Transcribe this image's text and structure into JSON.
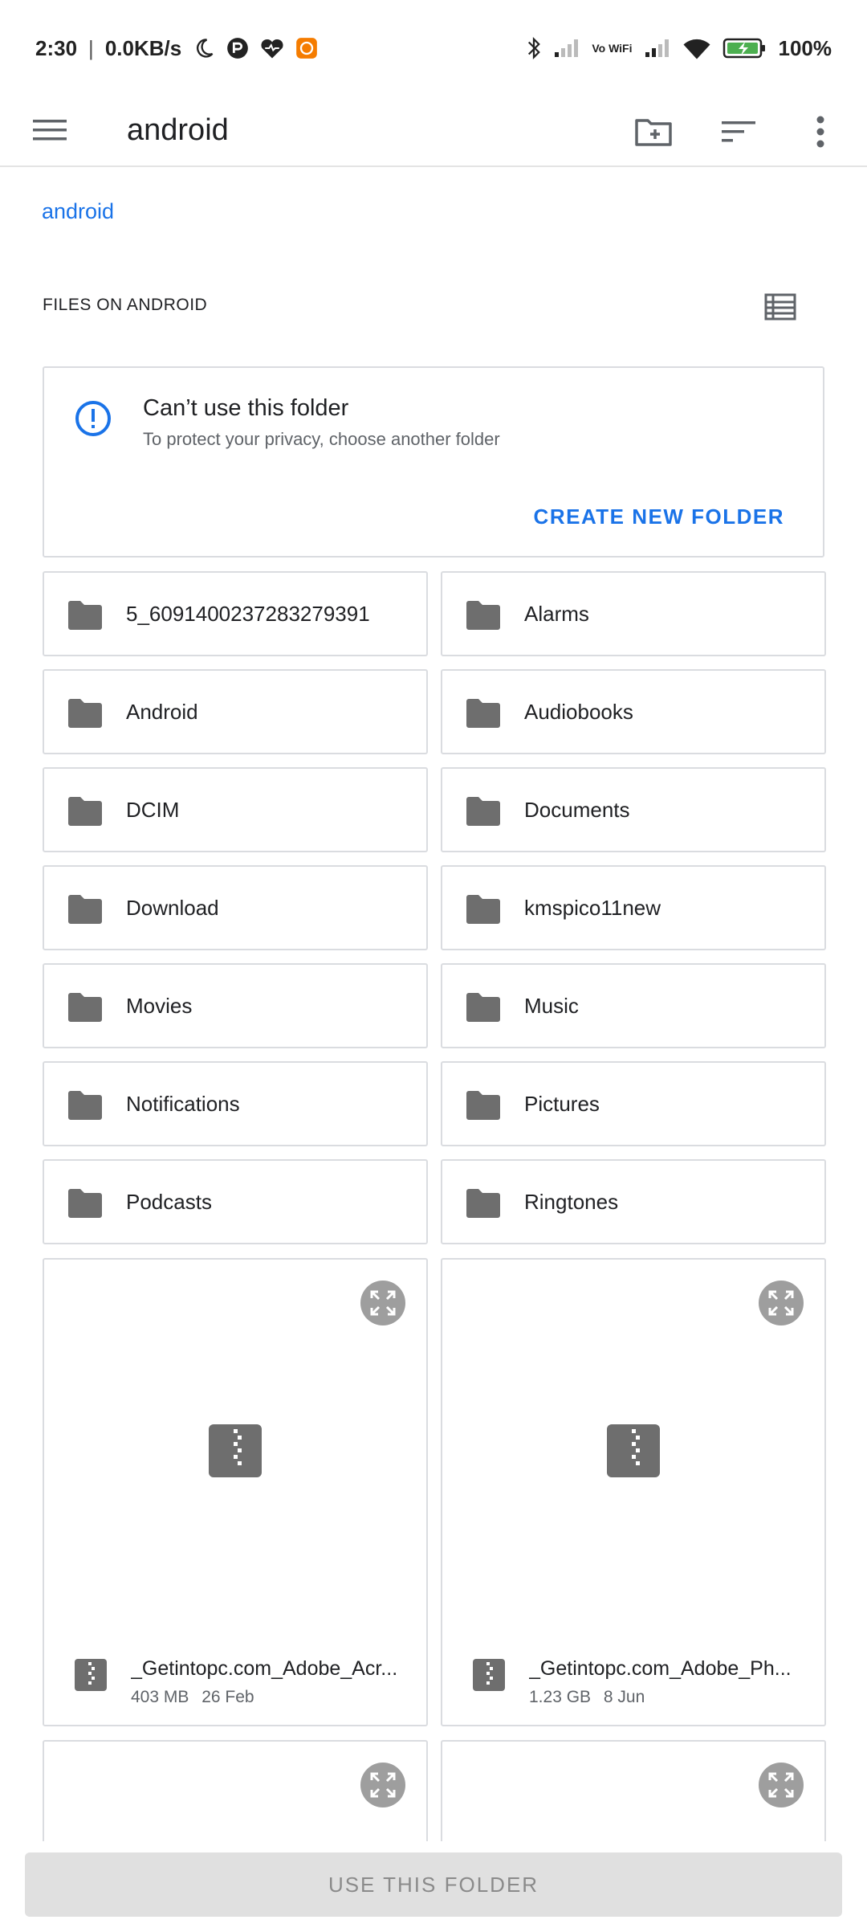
{
  "status_bar": {
    "time": "2:30",
    "network_speed": "0.0KB/s",
    "battery": "100%",
    "wifi_label": "Vo WiFi"
  },
  "app_bar": {
    "title": "android",
    "icons": [
      "menu-icon",
      "new-folder-icon",
      "sort-icon",
      "more-vert-icon"
    ]
  },
  "breadcrumb": "android",
  "section_title": "FILES ON ANDROID",
  "warning": {
    "title": "Can’t use this folder",
    "subtitle": "To protect your privacy, choose another folder",
    "action": "CREATE NEW FOLDER",
    "accent": "#1a73e8"
  },
  "folders": [
    "5_6091400237283279391",
    "Alarms",
    "Android",
    "Audiobooks",
    "DCIM",
    "Documents",
    "Download",
    "kmspico11new",
    "Movies",
    "Music",
    "Notifications",
    "Pictures",
    "Podcasts",
    "Ringtones"
  ],
  "files": [
    {
      "name": "_Getintopc.com_Adobe_Acr...",
      "size": "403 MB",
      "date": "26 Feb"
    },
    {
      "name": "_Getintopc.com_Adobe_Ph...",
      "size": "1.23 GB",
      "date": "8 Jun"
    }
  ],
  "bottom_button": "USE THIS FOLDER"
}
